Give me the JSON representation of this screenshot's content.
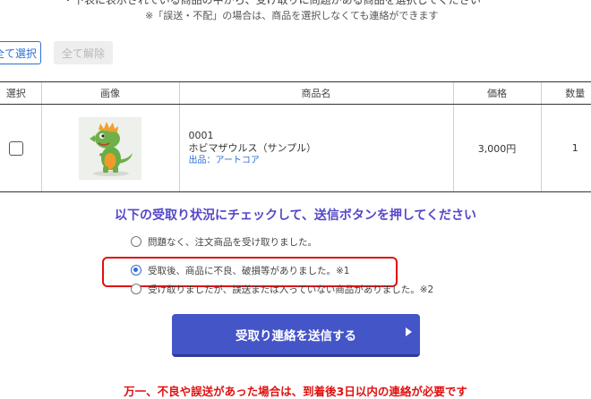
{
  "header": {
    "top_cut_text": "・下表に表示されている商品の中から、受け取りに問題がある商品を選択してください",
    "notice": "※「誤送・不配」の場合は、商品を選択しなくても連絡ができます"
  },
  "buttons": {
    "select_all": "全て選択",
    "deselect_all": "全て解除"
  },
  "table": {
    "headers": [
      "選択",
      "画像",
      "商品名",
      "価格",
      "数量"
    ],
    "rows": [
      {
        "code": "0001",
        "name": "ホビマザウルス（サンプル）",
        "seller": "出品：アートコア",
        "price": "3,000円",
        "qty": "1",
        "checked": false,
        "image": "green-dinosaur-figure"
      }
    ]
  },
  "instruction": "以下の受取り状況にチェックして、送信ボタンを押してください",
  "options": [
    {
      "label": "問題なく、注文商品を受け取りました。",
      "selected": false
    },
    {
      "label": "受取後、商品に不良、破損等がありました。※1",
      "selected": true
    },
    {
      "label": "受け取りましたが、誤送または入っていない商品がありました。※2",
      "selected": false
    }
  ],
  "submit_label": "受取り連絡を送信する",
  "warning": "万一、不良や誤送があった場合は、到着後3日以内の連絡が必要です",
  "colors": {
    "accent": "#2f6fd6",
    "heading": "#5448c8",
    "submit": "#4455c8",
    "warning": "#e01010"
  }
}
